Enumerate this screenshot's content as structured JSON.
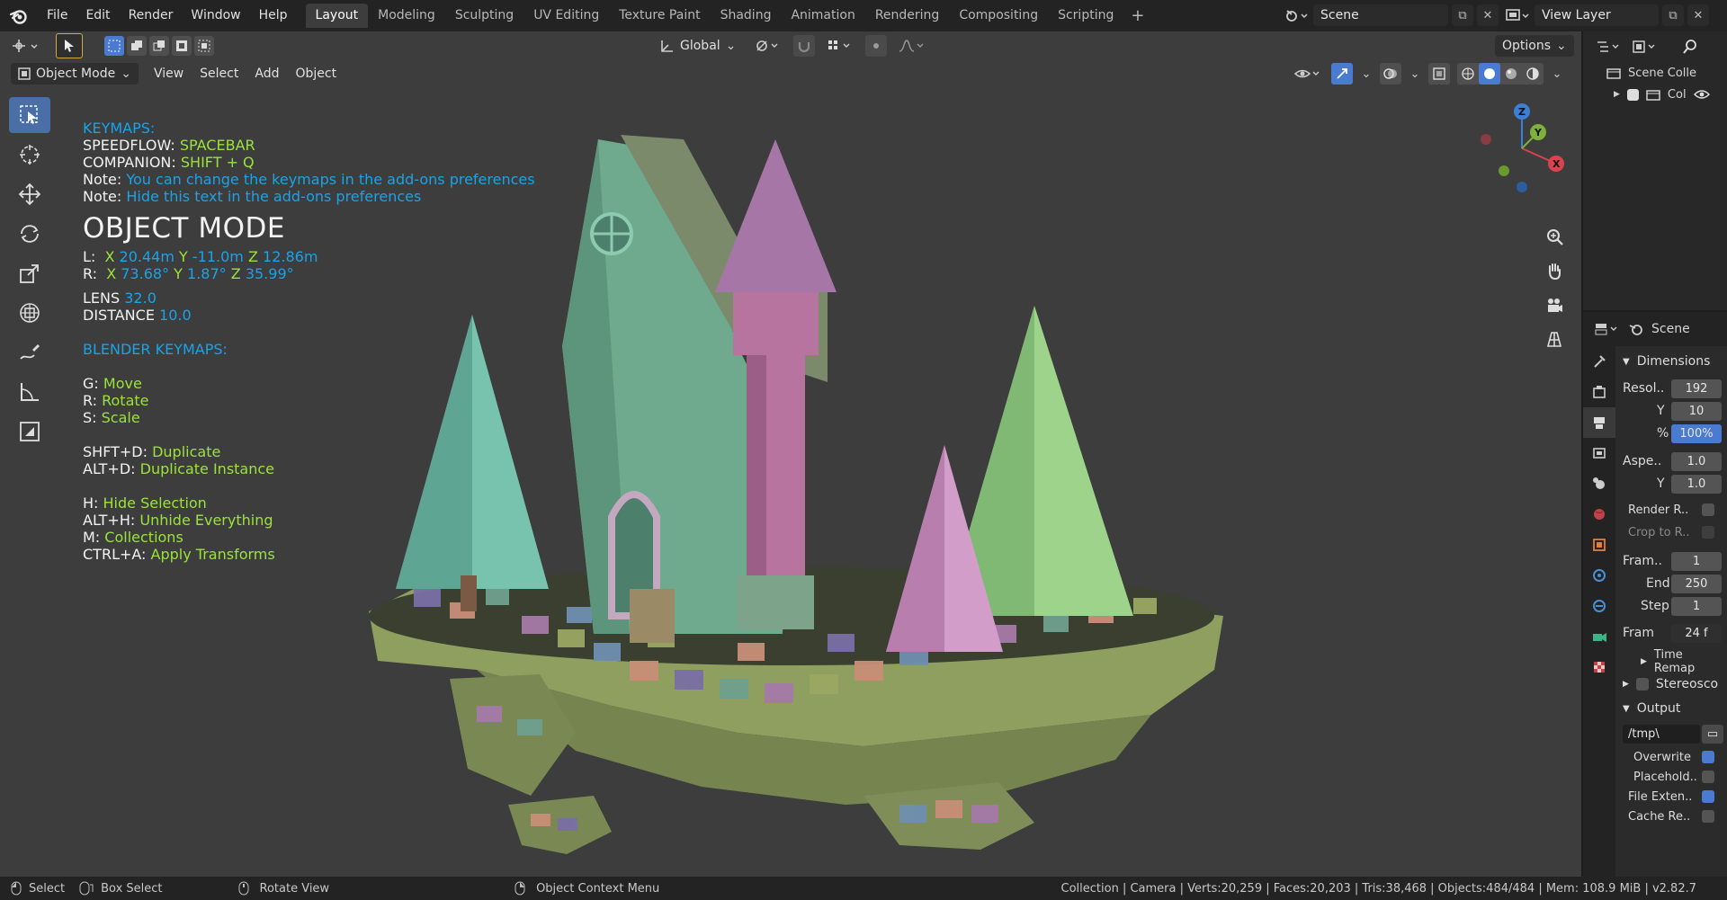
{
  "menu": [
    "File",
    "Edit",
    "Render",
    "Window",
    "Help"
  ],
  "workspace_tabs": [
    "Layout",
    "Modeling",
    "Sculpting",
    "UV Editing",
    "Texture Paint",
    "Shading",
    "Animation",
    "Rendering",
    "Compositing",
    "Scripting"
  ],
  "active_tab": "Layout",
  "scene_name": "Scene",
  "view_layer": "View Layer",
  "viewport": {
    "transform_orientation": "Global",
    "options_label": "Options",
    "mode": "Object Mode",
    "menus": [
      "View",
      "Select",
      "Add",
      "Object"
    ]
  },
  "overlay": {
    "keymaps_title": "KEYMAPS:",
    "speedflow_label": "SPEEDFLOW:",
    "speedflow_key": "SPACEBAR",
    "companion_label": "COMPANION:",
    "companion_key": "SHIFT + Q",
    "note_label": "Note:",
    "note1": "You can change the keymaps in the add-ons preferences",
    "note2": "Hide this text in the add-ons preferences",
    "mode_title": "OBJECT MODE",
    "loc_label": "L:",
    "loc_x_label": "X",
    "loc_x": "20.44m",
    "loc_y_label": "Y",
    "loc_y": "-11.0m",
    "loc_z_label": "Z",
    "loc_z": "12.86m",
    "rot_label": "R:",
    "rot_x_label": "X",
    "rot_x": "73.68°",
    "rot_y_label": "Y",
    "rot_y": "1.87°",
    "rot_z_label": "Z",
    "rot_z": "35.99°",
    "lens_label": "LENS",
    "lens": "32.0",
    "distance_label": "DISTANCE",
    "distance": "10.0",
    "blender_keymaps_title": "BLENDER KEYMAPS:",
    "shortcuts": [
      {
        "key": "G:",
        "action": "Move"
      },
      {
        "key": "R:",
        "action": "Rotate"
      },
      {
        "key": "S:",
        "action": "Scale"
      },
      {
        "key": "SHFT+D:",
        "action": "Duplicate"
      },
      {
        "key": "ALT+D:",
        "action": "Duplicate Instance"
      },
      {
        "key": "H:",
        "action": "Hide Selection"
      },
      {
        "key": "ALT+H:",
        "action": "Unhide Everything"
      },
      {
        "key": "M:",
        "action": "Collections"
      },
      {
        "key": "CTRL+A:",
        "action": "Apply Transforms"
      }
    ]
  },
  "gizmo": {
    "x": "X",
    "y": "Y",
    "z": "Z"
  },
  "outliner": {
    "root": "Scene Colle",
    "child": "Col"
  },
  "properties": {
    "context": "Scene",
    "dimensions_panel": "Dimensions",
    "resol_label": "Resol..",
    "resol_x": "192",
    "y_label": "Y",
    "resol_y": "10",
    "pct_label": "%",
    "pct": "100%",
    "aspect_label": "Aspe..",
    "aspect_x": "1.0",
    "aspect_y_label": "Y",
    "aspect_y": "1.0",
    "render_region": "Render R..",
    "crop_region": "Crop to R..",
    "frame_start_label": "Fram..",
    "frame_start": "1",
    "end_label": "End",
    "frame_end": "250",
    "step_label": "Step",
    "frame_step": "1",
    "frame_rate_label": "Fram",
    "frame_rate": "24 f",
    "time_remap": "Time Remap",
    "stereoscopy": "Stereosco",
    "output_panel": "Output",
    "output_path": "/tmp\\",
    "overwrite": "Overwrite",
    "placeholders": "Placehold..",
    "file_extensions": "File Exten..",
    "cache_result": "Cache Re.."
  },
  "status": {
    "select": "Select",
    "box_select": "Box Select",
    "rotate_view": "Rotate View",
    "context_menu": "Object Context Menu",
    "stats": "Collection | Camera | Verts:20,259 | Faces:20,203 | Tris:38,468 | Objects:484/484 | Mem: 108.9 MiB | v2.82.7"
  },
  "colors": {
    "accent": "#4a7bd0",
    "overlay_blue": "#1aa3e8",
    "overlay_green": "#9ae33b"
  }
}
